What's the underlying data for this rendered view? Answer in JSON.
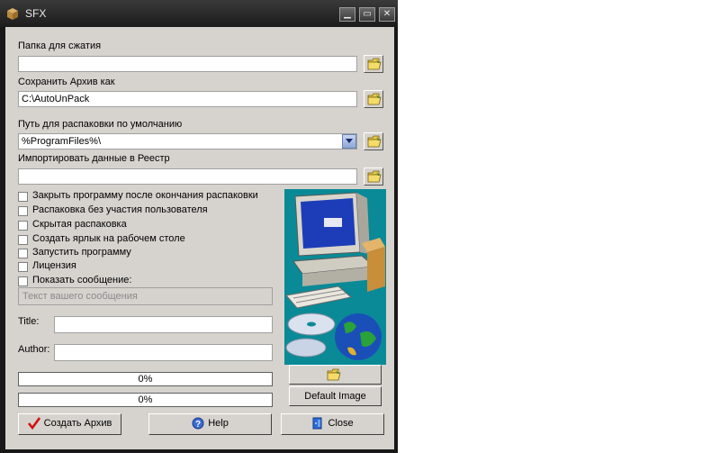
{
  "window": {
    "title": "SFX"
  },
  "fields": {
    "compress_folder_label": "Папка для сжатия",
    "compress_folder_value": "",
    "save_archive_label": "Сохранить Архив как",
    "save_archive_value": "C:\\AutoUnPack",
    "extract_path_label": "Путь для распаковки по умолчанию",
    "extract_path_value": "%ProgramFiles%\\",
    "import_registry_label": "Импортировать данные в Реестр",
    "import_registry_value": ""
  },
  "options": [
    {
      "label": "Закрыть программу после окончания распаковки",
      "checked": false
    },
    {
      "label": "Распаковка без участия пользователя",
      "checked": false
    },
    {
      "label": "Скрытая распаковка",
      "checked": false
    },
    {
      "label": "Создать ярлык на рабочем столе",
      "checked": false
    },
    {
      "label": "Запустить программу",
      "checked": false
    },
    {
      "label": "Лицензия",
      "checked": false
    },
    {
      "label": "Показать сообщение:",
      "checked": false
    }
  ],
  "message": {
    "placeholder": "Текст вашего сообщения"
  },
  "meta": {
    "title_label": "Title:",
    "title_value": "",
    "author_label": "Author:",
    "author_value": ""
  },
  "progress": [
    {
      "label": "0%",
      "value": 0
    },
    {
      "label": "0%",
      "value": 0
    }
  ],
  "buttons": {
    "create_archive": "Создать Архив",
    "help": "Help",
    "close": "Close",
    "default_image": "Default Image"
  },
  "icons": {
    "browse": "folder-open-icon",
    "dropdown": "chevron-down-icon",
    "create": "checkmark-icon",
    "help": "help-icon",
    "close": "close-door-icon",
    "app": "box-icon"
  },
  "colors": {
    "title_bar": "#2a2a2a",
    "dialog": "#d6d3ce",
    "picture_bg": "#0a8a96",
    "check_red": "#d01010"
  }
}
